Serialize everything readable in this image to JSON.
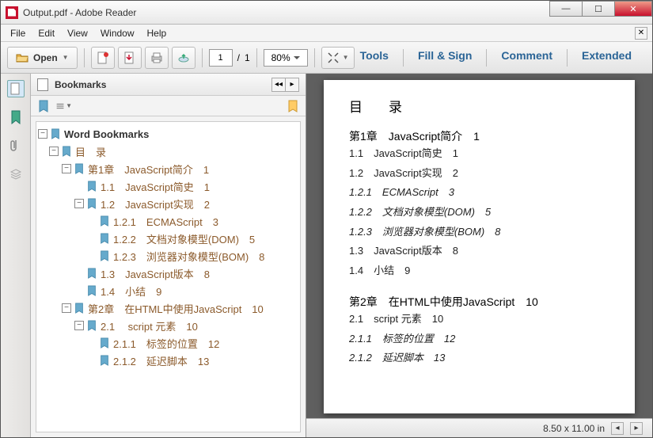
{
  "window": {
    "title": "Output.pdf - Adobe Reader"
  },
  "menu": {
    "file": "File",
    "edit": "Edit",
    "view": "View",
    "window": "Window",
    "help": "Help"
  },
  "toolbar": {
    "open": "Open",
    "page_current": "1",
    "page_sep": "/",
    "page_total": "1",
    "zoom": "80%"
  },
  "rlinks": {
    "tools": "Tools",
    "fillsign": "Fill & Sign",
    "comment": "Comment",
    "extended": "Extended"
  },
  "bookmarks": {
    "title": "Bookmarks",
    "root": "Word Bookmarks",
    "tree": [
      {
        "d": 1,
        "exp": "-",
        "t": "目　录"
      },
      {
        "d": 2,
        "exp": "-",
        "t": "第1章　JavaScript简介　1"
      },
      {
        "d": 3,
        "exp": "",
        "t": "1.1　JavaScript简史　1"
      },
      {
        "d": 3,
        "exp": "-",
        "t": "1.2　JavaScript实现　2"
      },
      {
        "d": 4,
        "exp": "",
        "t": "1.2.1　ECMAScript　3"
      },
      {
        "d": 4,
        "exp": "",
        "t": "1.2.2　文档对象模型(DOM)　5"
      },
      {
        "d": 4,
        "exp": "",
        "t": "1.2.3　浏览器对象模型(BOM)　8"
      },
      {
        "d": 3,
        "exp": "",
        "t": "1.3　JavaScript版本　8"
      },
      {
        "d": 3,
        "exp": "",
        "t": "1.4　小结　9"
      },
      {
        "d": 2,
        "exp": "-",
        "t": "第2章　在HTML中使用JavaScript　10"
      },
      {
        "d": 3,
        "exp": "-",
        "t": "2.1　 script 元素　10"
      },
      {
        "d": 4,
        "exp": "",
        "t": "2.1.1　标签的位置　12"
      },
      {
        "d": 4,
        "exp": "",
        "t": "2.1.2　延迟脚本　13"
      }
    ]
  },
  "doc": {
    "heading": "目　录",
    "lines": [
      {
        "c": "dch",
        "t": "第1章　JavaScript简介　1"
      },
      {
        "c": "dl",
        "t": "1.1　JavaScript简史　1"
      },
      {
        "c": "dl",
        "t": "1.2　JavaScript实现　2"
      },
      {
        "c": "dl it",
        "t": "1.2.1　ECMAScript　3"
      },
      {
        "c": "dl it",
        "t": "1.2.2　文档对象模型(DOM)　5"
      },
      {
        "c": "dl it",
        "t": "1.2.3　浏览器对象模型(BOM)　8"
      },
      {
        "c": "dl",
        "t": "1.3　JavaScript版本　8"
      },
      {
        "c": "dl",
        "t": "1.4　小结　9"
      },
      {
        "c": "dch",
        "t": "第2章　在HTML中使用JavaScript　10"
      },
      {
        "c": "dl",
        "t": "2.1　script 元素　10"
      },
      {
        "c": "dl it",
        "t": "2.1.1　标签的位置　12"
      },
      {
        "c": "dl it",
        "t": "2.1.2　延迟脚本　13"
      }
    ]
  },
  "status": {
    "size": "8.50 x 11.00 in"
  }
}
